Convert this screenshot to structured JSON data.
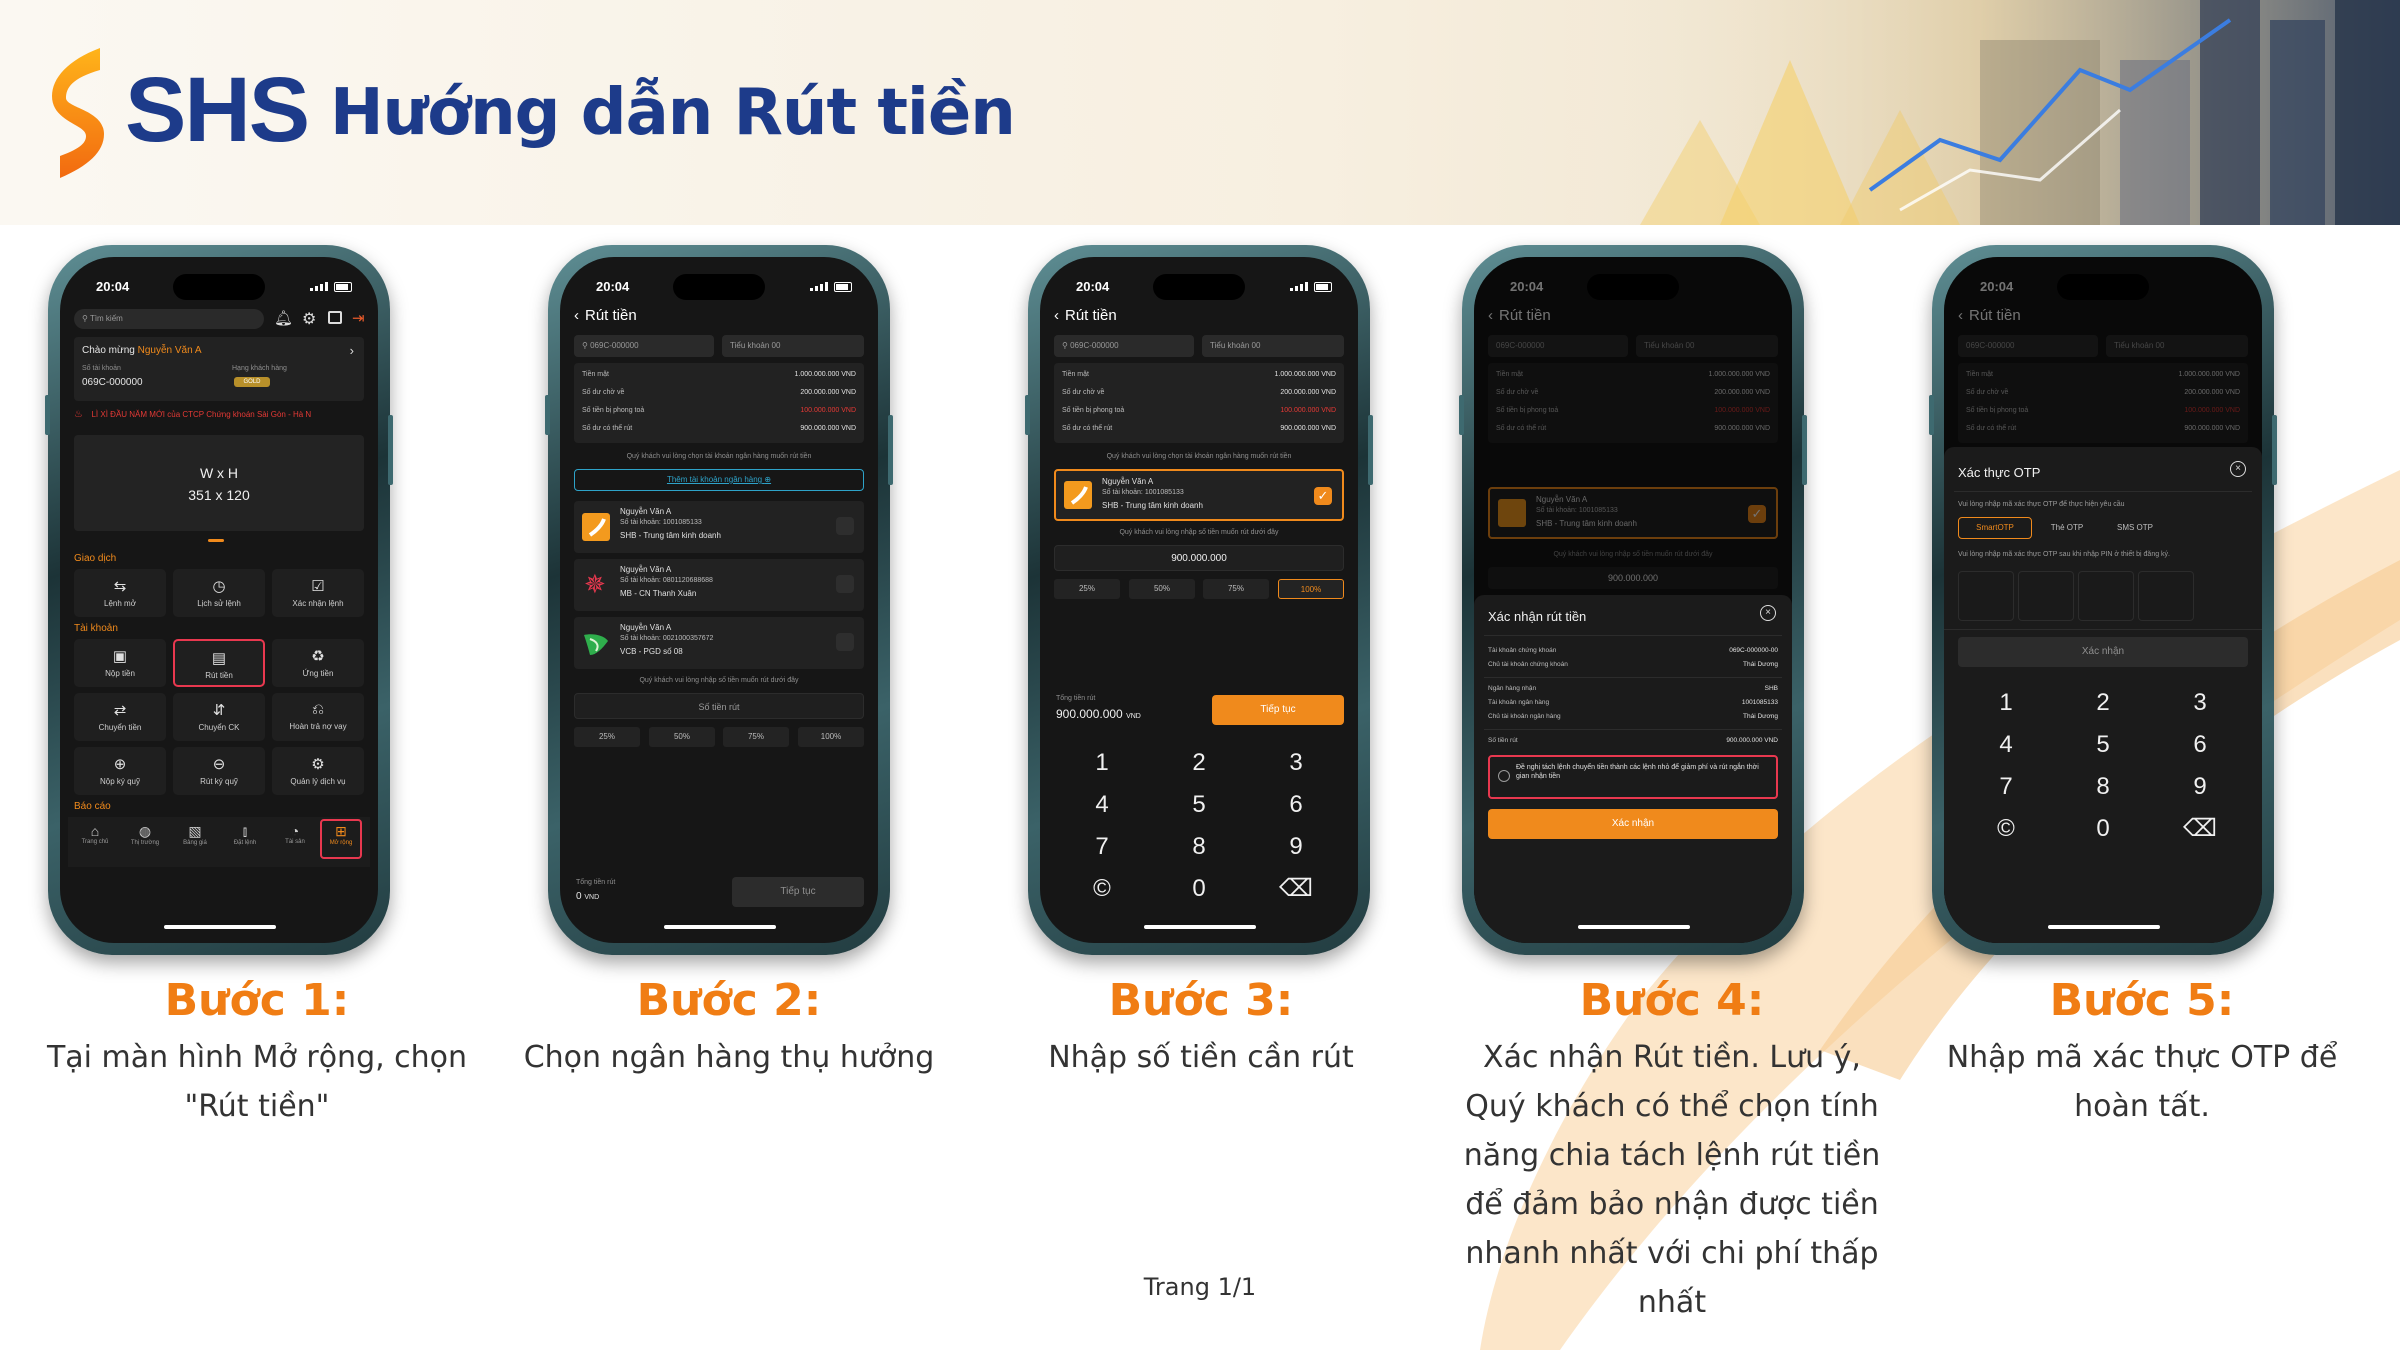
{
  "header": {
    "brand": "SHS",
    "title": "Hướng dẫn Rút tiền"
  },
  "colors": {
    "brand_blue": "#1d3b8a",
    "accent_orange": "#f07d14",
    "button_orange": "#f08a1c",
    "screen_bg": "#161616"
  },
  "phone1": {
    "time": "20:04",
    "search_placeholder": "Tìm kiếm",
    "greeting": "Chào mừng",
    "user_name": "Nguyễn Văn A",
    "account_label": "Số tài khoản",
    "account_no": "069C-000000",
    "tier_label": "Hạng khách hàng",
    "tier": "GOLD",
    "ticker": "LÌ XÌ ĐẦU NĂM MỚI của CTCP Chứng khoán Sài Gòn - Hà N",
    "banner_line1": "W x H",
    "banner_line2": "351 x 120",
    "section_trade": "Giao dịch",
    "trade_items": [
      "Lệnh mở",
      "Lịch sử lệnh",
      "Xác nhận lệnh"
    ],
    "section_account": "Tài khoản",
    "account_items": [
      "Nộp tiền",
      "Rút tiền",
      "Ứng tiền",
      "Chuyển tiền",
      "Chuyển CK",
      "Hoàn trả nợ vay",
      "Nộp ký quỹ",
      "Rút ký quỹ",
      "Quản lý dịch vụ"
    ],
    "section_report": "Báo cáo",
    "tabbar": [
      "Trang chủ",
      "Thị trường",
      "Bảng giá",
      "Đặt lệnh",
      "Tài sản",
      "Mở rộng"
    ]
  },
  "withdraw_form": {
    "title": "Rút tiền",
    "account_field": "069C-000000",
    "sub_account": "Tiểu khoản 00",
    "balances": [
      {
        "label": "Tiền mặt",
        "value": "1.000.000.000 VND"
      },
      {
        "label": "Số dư chờ về",
        "value": "200.000.000 VND"
      },
      {
        "label": "Số tiền bị phong toả",
        "value": "100.000.000 VND"
      },
      {
        "label": "Số dư có thể rút",
        "value": "900.000.000 VND"
      }
    ],
    "choose_bank_note": "Quý khách vui lòng chọn tài khoản ngân hàng muốn rút tiền",
    "add_bank": "Thêm tài khoản ngân hàng",
    "banks": [
      {
        "name": "Nguyễn Văn A",
        "account_label": "Số tài khoản:",
        "account": "1001085133",
        "branch": "SHB - Trung tâm kinh doanh"
      },
      {
        "name": "Nguyễn Văn A",
        "account_label": "Số tài khoản:",
        "account": "0801120688688",
        "branch": "MB - CN Thanh Xuân"
      },
      {
        "name": "Nguyễn Văn A",
        "account_label": "Số tài khoản:",
        "account": "0021000357672",
        "branch": "VCB - PGD số 08"
      }
    ],
    "amount_note": "Quý khách vui lòng nhập số tiền muốn rút dưới đây",
    "amount_placeholder": "Số tiền rút",
    "percents": [
      "25%",
      "50%",
      "75%",
      "100%"
    ],
    "total_label": "Tổng tiền rút",
    "total_zero": "0",
    "currency": "VND",
    "continue": "Tiếp tục",
    "amount_value": "900.000.000",
    "total_value": "900.000.000"
  },
  "keypad": [
    "1",
    "2",
    "3",
    "4",
    "5",
    "6",
    "7",
    "8",
    "9",
    "©",
    "0",
    "⌫"
  ],
  "confirm": {
    "title": "Xác nhận rút tiền",
    "rows": [
      {
        "label": "Tài khoản chứng khoán",
        "value": "069C-000000-00"
      },
      {
        "label": "Chủ tài khoản chứng khoán",
        "value": "Thái Dương"
      },
      {
        "label": "Ngân hàng nhận",
        "value": "SHB"
      },
      {
        "label": "Tài khoản ngân hàng",
        "value": "1001085133"
      },
      {
        "label": "Chủ tài khoản ngân hàng",
        "value": "Thái Dương"
      },
      {
        "label": "Số tiền rút",
        "value": "900.000.000 VND"
      }
    ],
    "split_text": "Đề nghị tách lệnh chuyển tiền thành các lệnh nhỏ để giảm phí và rút ngắn thời gian nhận tiền",
    "button": "Xác nhận"
  },
  "otp": {
    "title": "Xác thực OTP",
    "subtitle": "Vui lòng nhập mã xác thực OTP để thực hiện yêu cầu",
    "tabs": [
      "SmartOTP",
      "Thẻ OTP",
      "SMS OTP"
    ],
    "hint": "Vui lòng nhập mã xác thực OTP sau khi nhập PIN ở thiết bị đăng ký.",
    "button": "Xác nhận"
  },
  "steps": [
    {
      "title": "Bước 1:",
      "desc": "Tại màn hình Mở rộng, chọn \"Rút tiền\""
    },
    {
      "title": "Bước 2:",
      "desc": "Chọn ngân hàng thụ hưởng"
    },
    {
      "title": "Bước 3:",
      "desc": "Nhập số tiền cần rút"
    },
    {
      "title": "Bước 4:",
      "desc": "Xác nhận Rút tiền. Lưu ý, Quý khách có thể chọn tính năng chia tách lệnh rút tiền để đảm bảo nhận được tiền nhanh nhất với chi phí thấp nhất"
    },
    {
      "title": "Bước 5:",
      "desc": "Nhập mã xác thực OTP để hoàn tất."
    }
  ],
  "footer": "Trang 1/1"
}
